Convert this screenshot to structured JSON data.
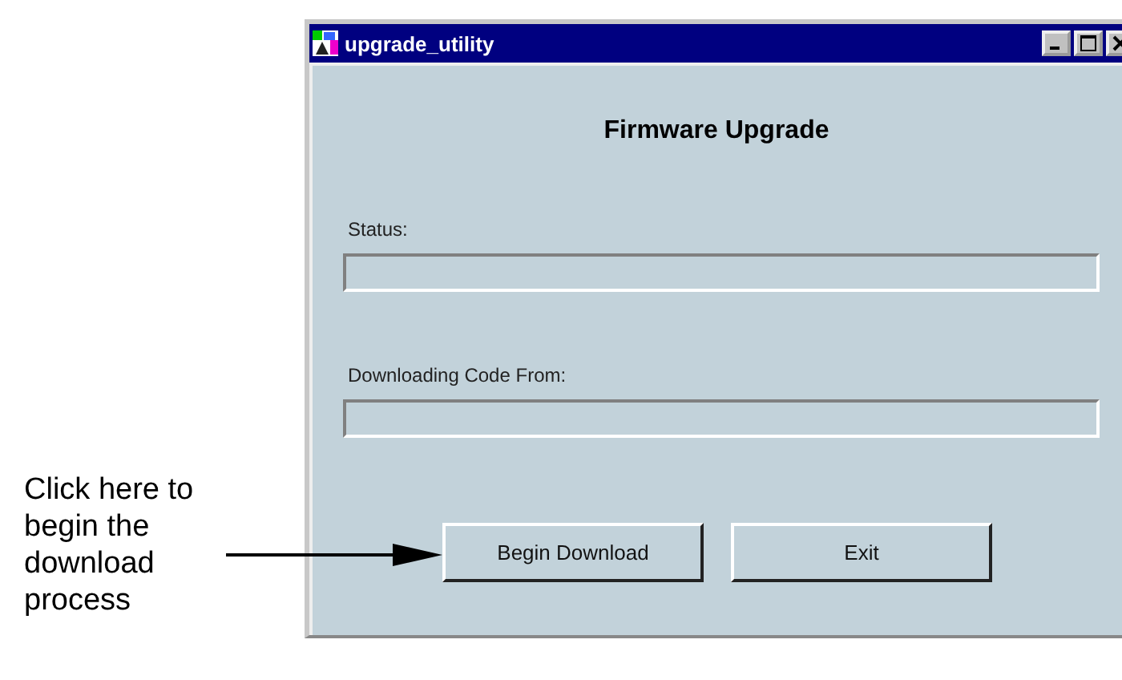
{
  "callout": {
    "text": "Click here to begin the download process"
  },
  "window": {
    "title": "upgrade_utility"
  },
  "heading": "Firmware Upgrade",
  "fields": [
    {
      "label": "Status:"
    },
    {
      "label": "Downloading Code From:"
    }
  ],
  "buttons": [
    {
      "label": "Begin Download"
    },
    {
      "label": "Exit"
    }
  ]
}
